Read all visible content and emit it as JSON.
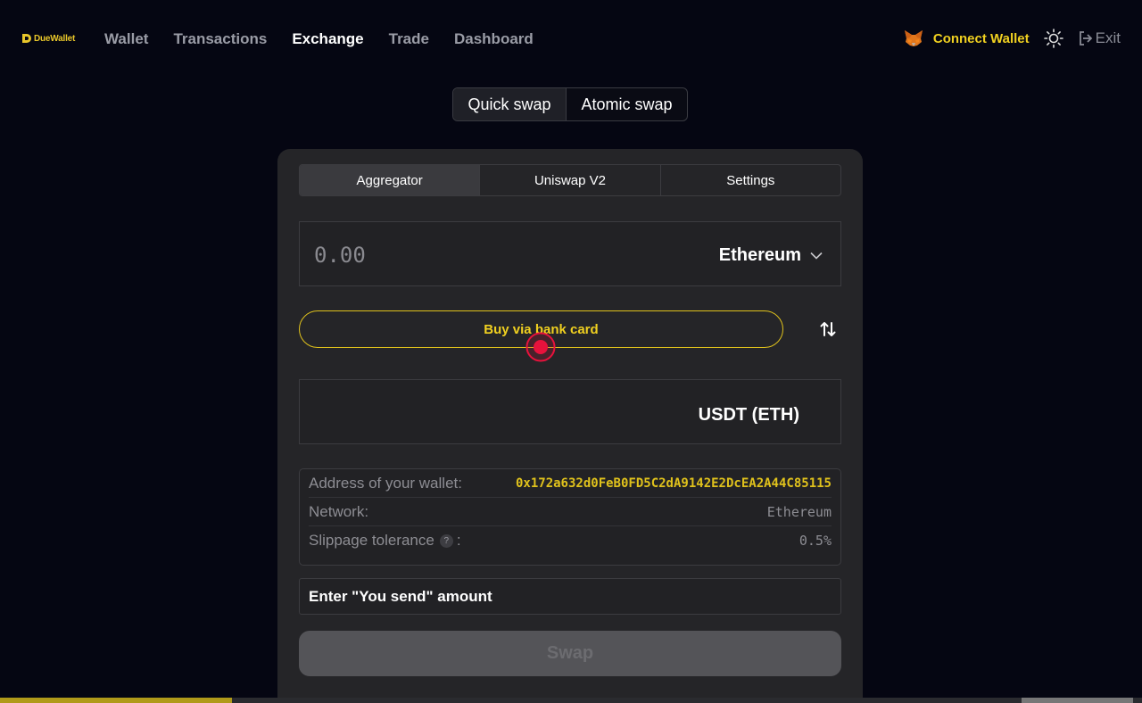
{
  "brand": {
    "name": "DueWallet",
    "color": "#e8c62a"
  },
  "nav": [
    {
      "label": "Wallet",
      "active": false
    },
    {
      "label": "Transactions",
      "active": false
    },
    {
      "label": "Exchange",
      "active": true
    },
    {
      "label": "Trade",
      "active": false
    },
    {
      "label": "Dashboard",
      "active": false
    }
  ],
  "header": {
    "connect_label": "Connect Wallet",
    "exit_label": "Exit",
    "wallet_icon": "metamask-fox-icon",
    "theme_icon": "sun-icon"
  },
  "swap_modes": [
    {
      "label": "Quick swap",
      "active": true
    },
    {
      "label": "Atomic swap",
      "active": false
    }
  ],
  "tabs": [
    {
      "label": "Aggregator",
      "active": true
    },
    {
      "label": "Uniswap V2",
      "active": false
    },
    {
      "label": "Settings",
      "active": false
    }
  ],
  "send": {
    "placeholder": "0.00",
    "value": "",
    "currency": "Ethereum"
  },
  "buy_button": "Buy via bank card",
  "receive": {
    "currency": "USDT (ETH)"
  },
  "info": {
    "address_label": "Address of your wallet:",
    "address_value": "0x172a632d0FeB0FD5C2dA9142E2DcEA2A44C85115",
    "network_label": "Network:",
    "network_value": "Ethereum",
    "slippage_label": "Slippage tolerance",
    "slippage_help": "?",
    "slippage_colon": ":",
    "slippage_value": "0.5%"
  },
  "status_message": "Enter \"You send\" amount",
  "swap_button": "Swap",
  "colors": {
    "accent": "#f0d020",
    "background": "#050612",
    "card": "#252528",
    "click_marker": "#e8123c"
  }
}
